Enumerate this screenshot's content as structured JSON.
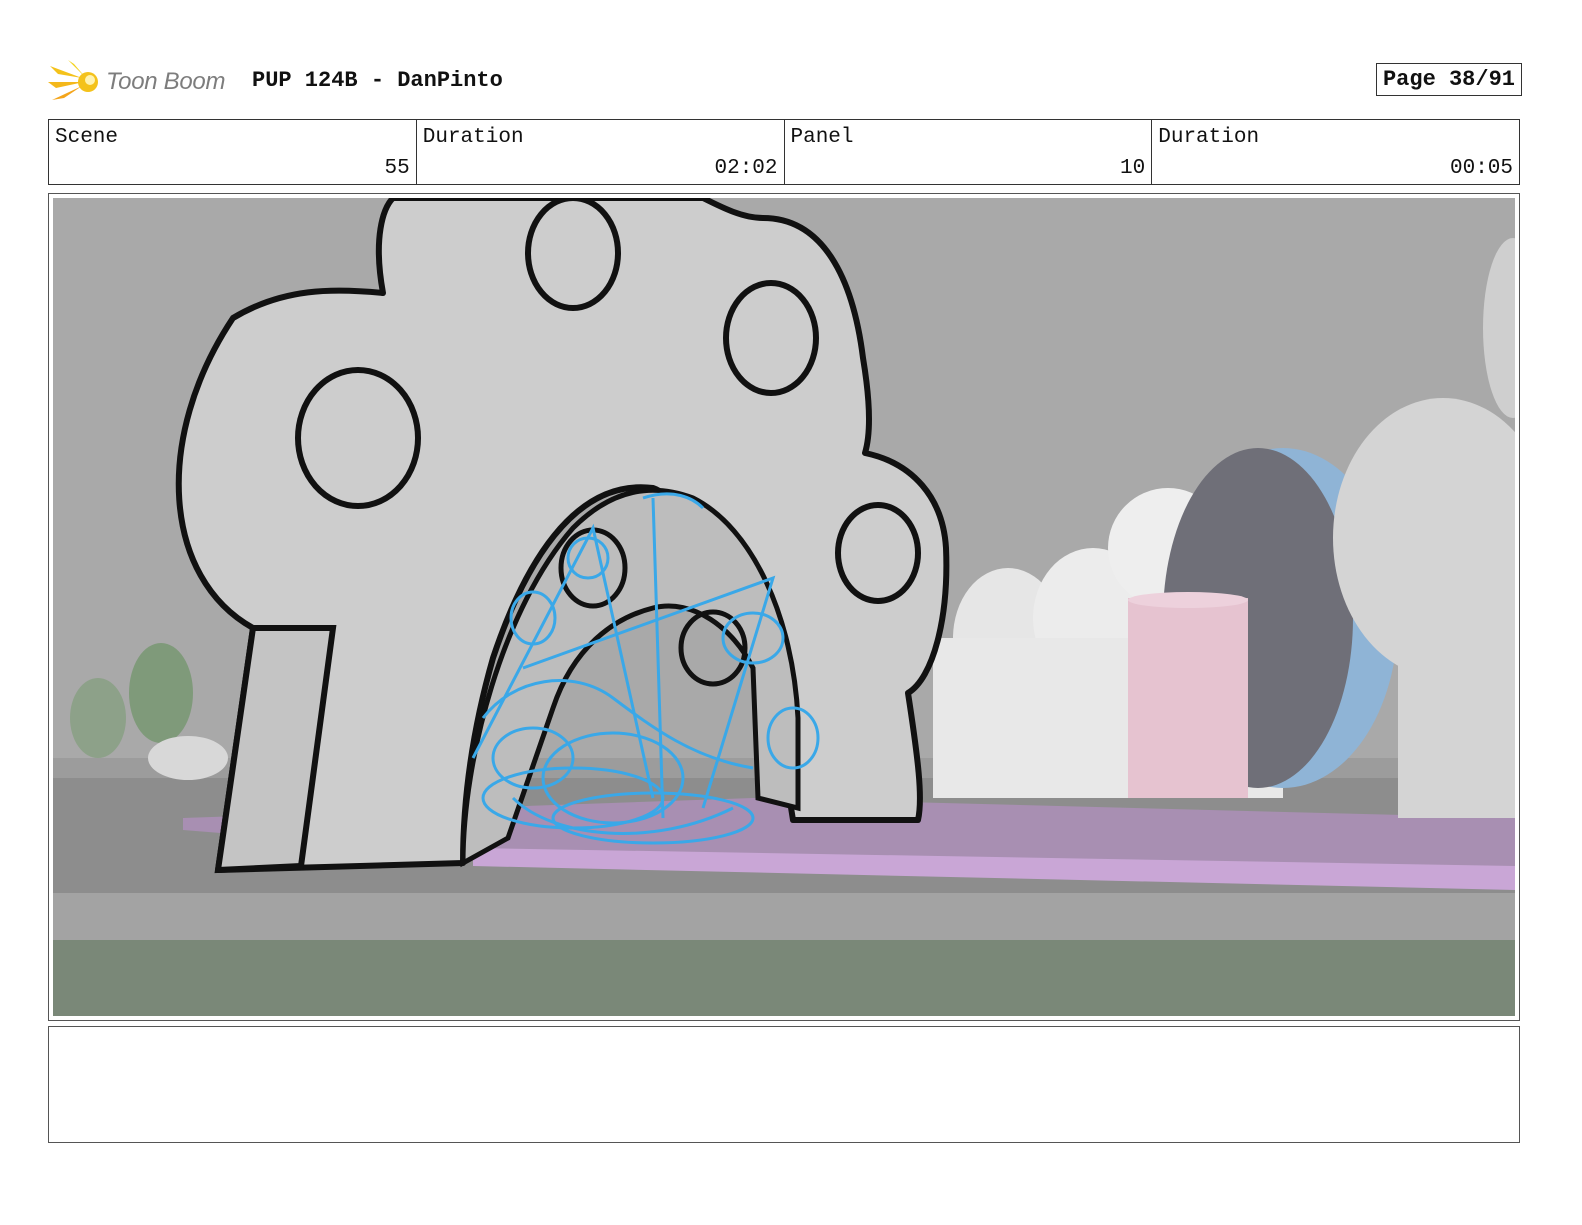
{
  "header": {
    "logo_text": "Toon Boom",
    "title": "PUP 124B - DanPinto",
    "page": "Page 38/91"
  },
  "info": {
    "scene_label": "Scene",
    "scene_value": "55",
    "duration_label": "Duration",
    "duration_value": "02:02",
    "panel_label": "Panel",
    "panel_value": "10",
    "panel_duration_label": "Duration",
    "panel_duration_value": "00:05"
  },
  "panel": {
    "description": ""
  },
  "notes": {
    "text": ""
  },
  "colors": {
    "sketch_blue": "#3aa8e8",
    "path_purple": "#b79ac9",
    "ground_dark": "#7a8878",
    "sky_gray": "#a8a8a8",
    "arch_fill": "#cdcdcd",
    "pink_cylinder": "#e6c3d0",
    "logo_yellow": "#f4c21b"
  }
}
